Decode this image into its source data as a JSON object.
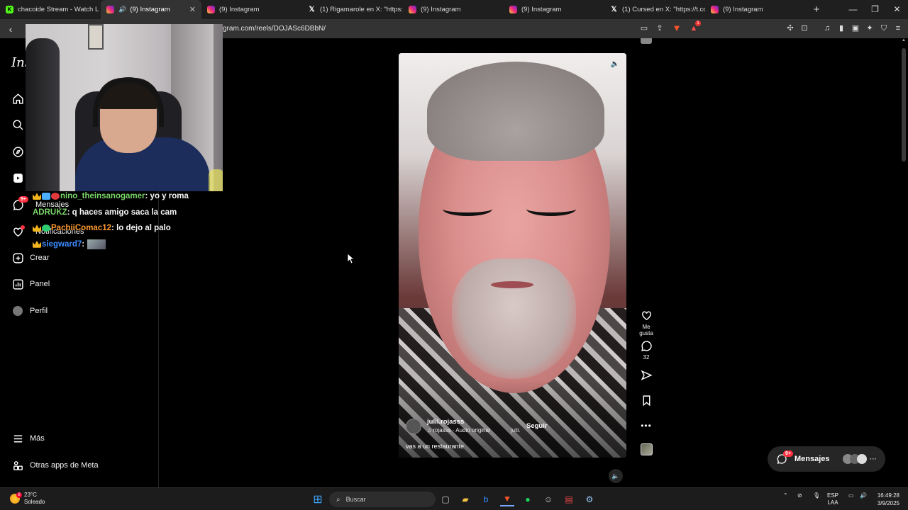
{
  "browser": {
    "tabs": [
      {
        "label": "chacoide Stream - Watch L",
        "icon": "twitch-icon",
        "active": false
      },
      {
        "label": "(9) Instagram",
        "icon": "instagram-icon",
        "active": true,
        "audio": true
      },
      {
        "label": "(9) Instagram",
        "icon": "instagram-icon",
        "active": false
      },
      {
        "label": "(1) Rigamarole en X: \"https://t.",
        "icon": "x-icon",
        "active": false
      },
      {
        "label": "(9) Instagram",
        "icon": "instagram-icon",
        "active": false
      },
      {
        "label": "(9) Instagram",
        "icon": "instagram-icon",
        "active": false
      },
      {
        "label": "(1) Cursed en X: \"https://t.co/S",
        "icon": "x-icon",
        "active": false
      },
      {
        "label": "(9) Instagram",
        "icon": "instagram-icon",
        "active": false
      }
    ],
    "new_tab": "+",
    "url": "gram.com/reels/DOJASc6DBbN/",
    "brave_rewards_count": "1"
  },
  "sidebar": {
    "logo": "Ins",
    "items": [
      {
        "name": "home",
        "label": "",
        "icon": "home-icon"
      },
      {
        "name": "search",
        "label": "",
        "icon": "search-icon"
      },
      {
        "name": "explore",
        "label": "",
        "icon": "compass-icon"
      },
      {
        "name": "reels",
        "label": "",
        "icon": "reels-icon"
      },
      {
        "name": "messages",
        "label": "Mensajes",
        "icon": "messenger-icon",
        "badge": "9+"
      },
      {
        "name": "notifications",
        "label": "Notificaciones",
        "icon": "heart-icon"
      },
      {
        "name": "create",
        "label": "Crear",
        "icon": "plus-square-icon"
      },
      {
        "name": "dashboard",
        "label": "Panel",
        "icon": "chart-icon"
      },
      {
        "name": "profile",
        "label": "Perfil",
        "icon": "avatar-icon"
      }
    ],
    "more": "Más",
    "meta_apps": "Otras apps de Meta"
  },
  "chat": [
    {
      "user": "nino_theinsanogamer",
      "colon": ":",
      "message": "yo y roma",
      "color": "#7bd66a",
      "badges": [
        "crown",
        "blue",
        "red"
      ]
    },
    {
      "user": "ADRUKZ",
      "colon": ":",
      "message": "q haces amigo saca la cam",
      "color": "#7bd66a",
      "badges": []
    },
    {
      "user": "PachiiComac12",
      "colon": ":",
      "message": "lo dejo al palo",
      "color": "#ff9a2e",
      "badges": [
        "crown",
        "green"
      ]
    },
    {
      "user": "siegward7",
      "colon": ":",
      "message": "",
      "color": "#3c8cff",
      "badges": [
        "crown"
      ],
      "emote": true
    }
  ],
  "reel": {
    "username": "julii.rojasss",
    "audio": "rojasss · Audio original",
    "audio_extra": "julii.",
    "follow": "Seguir",
    "caption": "vas a un restaurante",
    "like_label": "Me gusta",
    "comment_count": "32"
  },
  "messages_pill": {
    "label": "Mensajes",
    "badge": "9+"
  },
  "taskbar": {
    "temperature": "23°C",
    "weather": "Soleado",
    "weather_badge": "8",
    "search": "Buscar",
    "lang_top": "ESP",
    "lang_bottom": "LAA",
    "time": "16:49:28",
    "date": "3/9/2025"
  }
}
